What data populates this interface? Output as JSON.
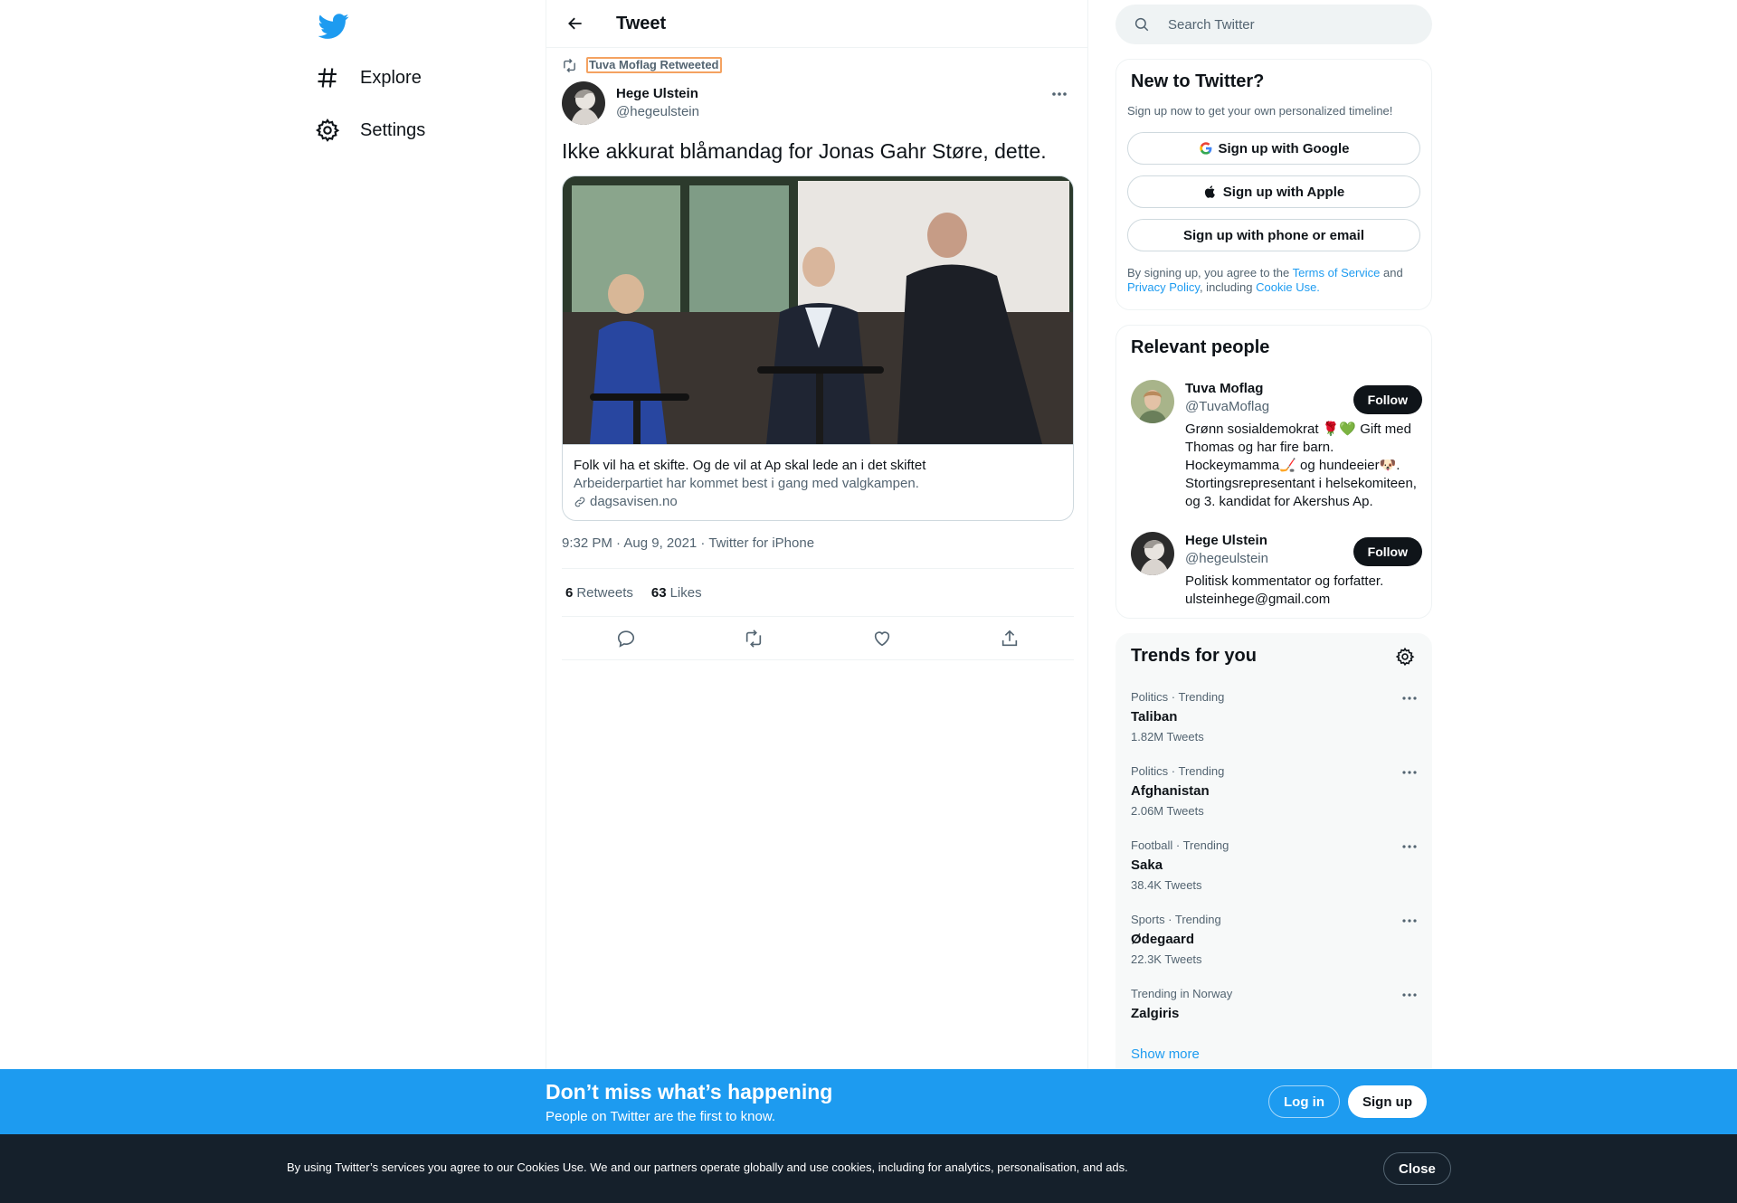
{
  "colors": {
    "accent": "#1d9bf0",
    "text_primary": "#0f1419",
    "text_secondary": "#536471",
    "border": "#eff3f4",
    "dark_banner": "#15202b",
    "retweet_highlight": "#f4a261"
  },
  "nav": {
    "logo_icon": "twitter-bird-icon",
    "items": [
      {
        "label": "Explore",
        "icon": "hashtag-icon"
      },
      {
        "label": "Settings",
        "icon": "gear-icon"
      }
    ]
  },
  "header": {
    "title": "Tweet",
    "back_icon": "arrow-left-icon"
  },
  "tweet": {
    "retweet_context": "Tuva Moflag Retweeted",
    "author": {
      "name": "Hege Ulstein",
      "handle": "@hegeulstein"
    },
    "text": "Ikke akkurat blåmandag for Jonas Gahr Støre, dette.",
    "card": {
      "title": "Folk vil ha et skifte. Og de vil at Ap skal lede an i det skiftet",
      "description": "Arbeiderpartiet har kommet best i gang med valgkampen.",
      "domain": "dagsavisen.no"
    },
    "meta": "9:32 PM · Aug 9, 2021 · Twitter for iPhone",
    "stats": {
      "retweets_count": "6",
      "retweets_label": "Retweets",
      "likes_count": "63",
      "likes_label": "Likes"
    },
    "actions": [
      "reply-icon",
      "retweet-icon",
      "like-icon",
      "share-icon"
    ]
  },
  "search": {
    "placeholder": "Search Twitter"
  },
  "signup_panel": {
    "title": "New to Twitter?",
    "subtitle": "Sign up now to get your own personalized timeline!",
    "google_label": "Sign up with Google",
    "apple_label": "Sign up with Apple",
    "phone_label": "Sign up with phone or email",
    "legal_prefix": "By signing up, you agree to the ",
    "terms_link": "Terms of Service",
    "legal_and": " and ",
    "privacy_link": "Privacy Policy",
    "legal_including": ", including ",
    "cookie_link": "Cookie Use."
  },
  "people_panel": {
    "title": "Relevant people",
    "people": [
      {
        "name": "Tuva Moflag",
        "handle": "@TuvaMoflag",
        "bio": "Grønn sosialdemokrat 🌹💚 Gift med Thomas og har fire barn. Hockeymamma🏒 og hundeeier🐶. Stortingsrepresentant i helsekomiteen, og 3. kandidat for Akershus Ap.",
        "follow_label": "Follow"
      },
      {
        "name": "Hege Ulstein",
        "handle": "@hegeulstein",
        "bio": "Politisk kommentator og forfatter. ulsteinhege@gmail.com",
        "follow_label": "Follow"
      }
    ]
  },
  "trends_panel": {
    "title": "Trends for you",
    "trends": [
      {
        "meta": "Politics · Trending",
        "name": "Taliban",
        "count": "1.82M Tweets"
      },
      {
        "meta": "Politics · Trending",
        "name": "Afghanistan",
        "count": "2.06M Tweets"
      },
      {
        "meta": "Football · Trending",
        "name": "Saka",
        "count": "38.4K Tweets"
      },
      {
        "meta": "Sports · Trending",
        "name": "Ødegaard",
        "count": "22.3K Tweets"
      },
      {
        "meta": "Trending in Norway",
        "name": "Zalgiris",
        "count": ""
      }
    ],
    "show_more": "Show more"
  },
  "login_bar": {
    "title": "Don’t miss what’s happening",
    "subtitle": "People on Twitter are the first to know.",
    "login_label": "Log in",
    "signup_label": "Sign up"
  },
  "cookie_bar": {
    "text": "By using Twitter’s services you agree to our Cookies Use. We and our partners operate globally and use cookies, including for analytics, personalisation, and ads.",
    "close_label": "Close"
  }
}
